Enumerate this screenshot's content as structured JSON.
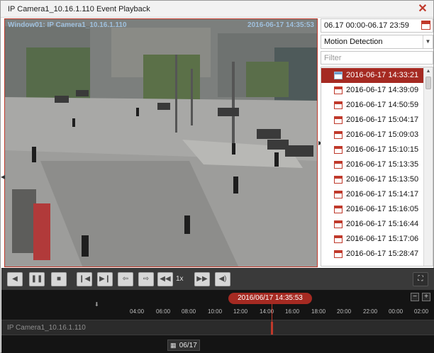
{
  "window": {
    "title": "IP Camera1_10.16.1.110 Event Playback",
    "close_glyph": "✕"
  },
  "video": {
    "osd_window": "Window01: IP Camera1_10.16.1.110",
    "osd_time": "2016-06-17 14:35:53"
  },
  "sidebar": {
    "time_range": "06.17 00:00-06.17 23:59",
    "event_type": "Motion Detection",
    "filter_placeholder": "Filter",
    "events": [
      {
        "label": "2016-06-17 14:33:21",
        "selected": true
      },
      {
        "label": "2016-06-17 14:39:09"
      },
      {
        "label": "2016-06-17 14:50:59"
      },
      {
        "label": "2016-06-17 15:04:17"
      },
      {
        "label": "2016-06-17 15:09:03"
      },
      {
        "label": "2016-06-17 15:10:15"
      },
      {
        "label": "2016-06-17 15:13:35"
      },
      {
        "label": "2016-06-17 15:13:50"
      },
      {
        "label": "2016-06-17 15:14:17"
      },
      {
        "label": "2016-06-17 15:16:05"
      },
      {
        "label": "2016-06-17 15:16:44"
      },
      {
        "label": "2016-06-17 15:17:06"
      },
      {
        "label": "2016-06-17 15:28:47"
      }
    ]
  },
  "toolbar": {
    "speed": "1x",
    "icons": [
      "stop-icon",
      "play-icon",
      "pause-icon",
      "stop-square-icon",
      "frame-back-icon",
      "frame-forward-icon",
      "rewind-icon",
      "forward-icon",
      "slow-icon",
      "fast-icon",
      "audio-icon",
      "fullscreen-icon"
    ]
  },
  "timeline": {
    "current": "2016/06/17 14:35:53",
    "camera": "IP Camera1_10.16.1.110",
    "date_label": "06/17",
    "zoom_out": "−",
    "zoom_in": "+",
    "hours": [
      "04:00",
      "06:00",
      "08:00",
      "10:00",
      "12:00",
      "14:00",
      "16:00",
      "18:00",
      "20:00",
      "22:00",
      "00:00",
      "02:00"
    ]
  },
  "colors": {
    "accent": "#a52a22",
    "dark_bg": "#141414",
    "toolbar_bg": "#3a3a3a"
  }
}
